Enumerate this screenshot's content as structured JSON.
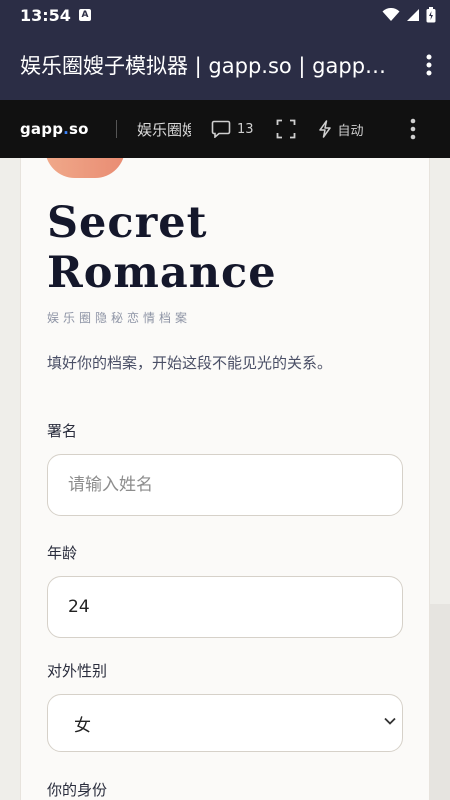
{
  "status_bar": {
    "time": "13:54",
    "notification_badge": "A"
  },
  "title_bar": {
    "title": "娱乐圈嫂子模拟器 | gapp.so | gapp.so"
  },
  "toolbar": {
    "brand_part1": "gapp",
    "brand_dot": ".",
    "brand_part2": "so",
    "app_name": "娱乐圈嫂子模拟器",
    "comment_count": "13",
    "auto_label": "自动"
  },
  "hero": {
    "title_line1": "Secret",
    "title_line2": "Romance",
    "subtitle": "娱乐圈隐秘恋情档案",
    "description": "填好你的档案，开始这段不能见光的关系。"
  },
  "form": {
    "name_label": "署名",
    "name_placeholder": "请输入姓名",
    "name_value": "",
    "age_label": "年龄",
    "age_value": "24",
    "gender_label": "对外性别",
    "gender_value": "女",
    "identity_label": "你的身份"
  },
  "colors": {
    "status_bg": "#2b2d45",
    "toolbar_bg": "#111111",
    "brand_accent": "#3b82f6",
    "title_text": "#14172b",
    "page_bg": "#efeeea"
  }
}
